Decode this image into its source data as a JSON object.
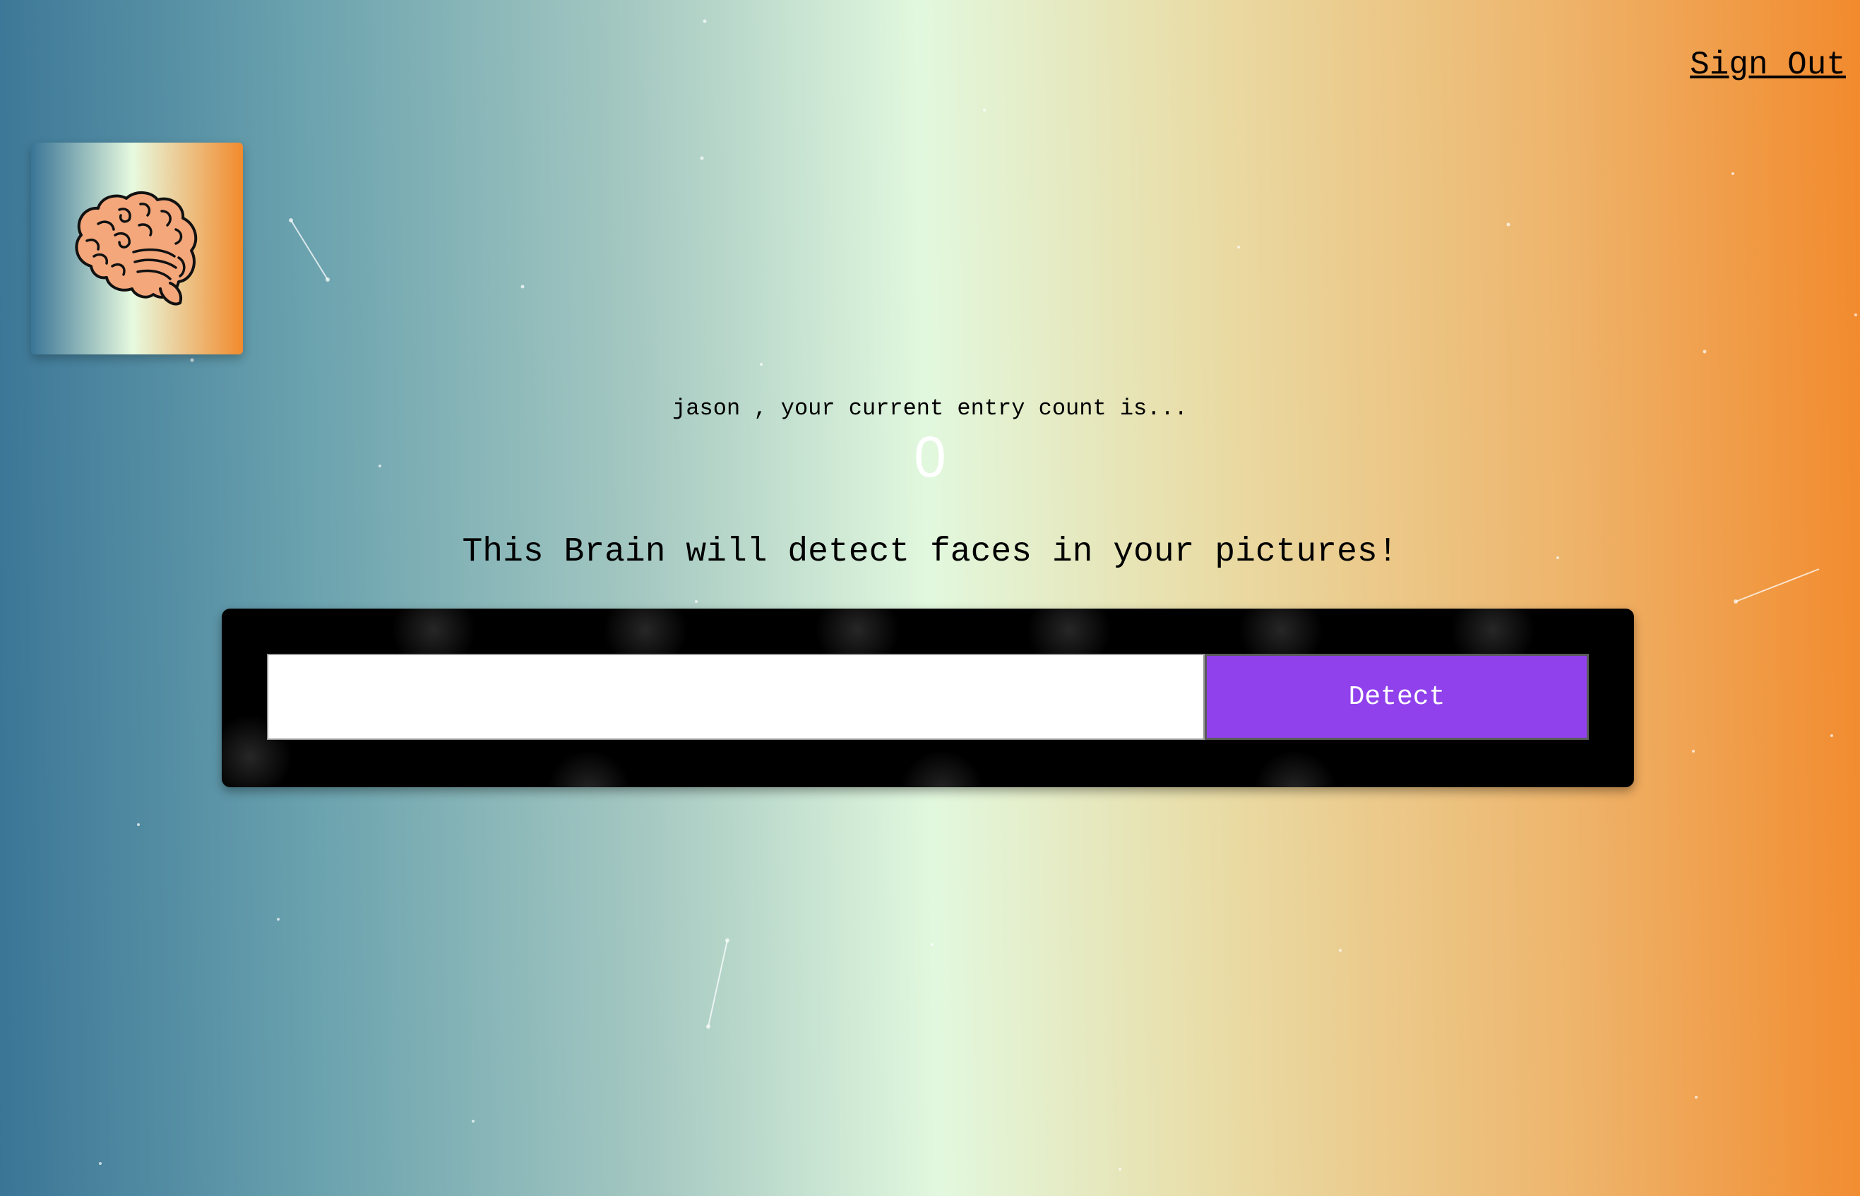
{
  "nav": {
    "sign_out_label": "Sign Out"
  },
  "logo": {
    "icon": "brain-icon"
  },
  "rank": {
    "message": "jason , your current entry count is...",
    "count": "0"
  },
  "headline": "This Brain will detect faces in your pictures!",
  "form": {
    "input_value": "",
    "button_label": "Detect"
  },
  "colors": {
    "gradient_left": "#3a7596",
    "gradient_mid": "#e2f8de",
    "gradient_right": "#f28a2d",
    "button": "#9041ec",
    "panel": "#000000"
  }
}
